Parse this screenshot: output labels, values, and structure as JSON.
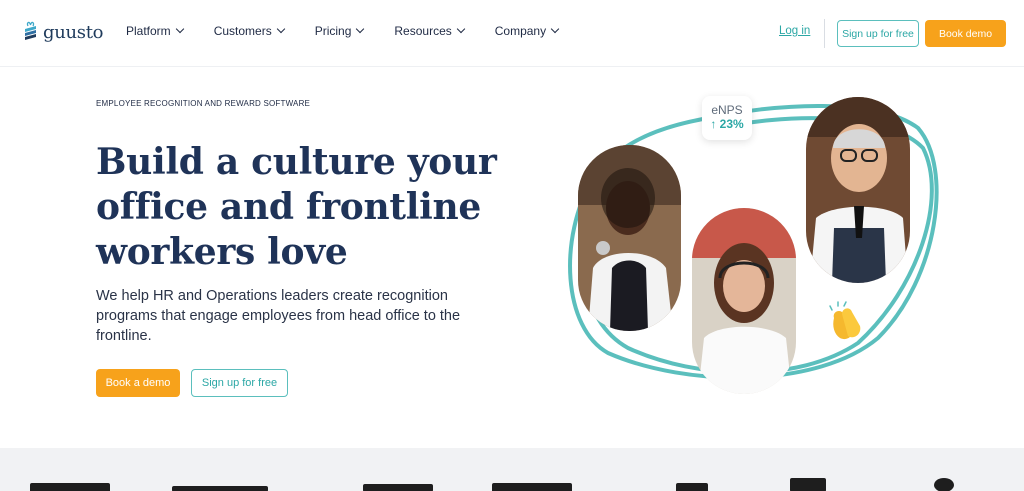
{
  "brand": {
    "name": "guusto"
  },
  "nav": {
    "items": [
      {
        "label": "Platform"
      },
      {
        "label": "Customers"
      },
      {
        "label": "Pricing"
      },
      {
        "label": "Resources"
      },
      {
        "label": "Company"
      }
    ],
    "login_label": "Log in",
    "signup_label": "Sign up for free",
    "demo_label": "Book demo"
  },
  "hero": {
    "eyebrow": "EMPLOYEE RECOGNITION AND REWARD SOFTWARE",
    "headline": "Build a culture your office and frontline workers love",
    "subtext": "We help HR and Operations leaders create recognition programs that engage employees from head office to the frontline.",
    "demo_label": "Book a demo",
    "signup_label": "Sign up for free"
  },
  "badge": {
    "label": "eNPS",
    "value": "↑ 23%"
  },
  "colors": {
    "accent": "#2ba7a5",
    "cta": "#f7a21b",
    "heading": "#1f3358",
    "ring": "#5bbfbd"
  },
  "icons": [
    "clapping-hands-icon",
    "chevron-down-icon",
    "gift-logo-icon"
  ]
}
